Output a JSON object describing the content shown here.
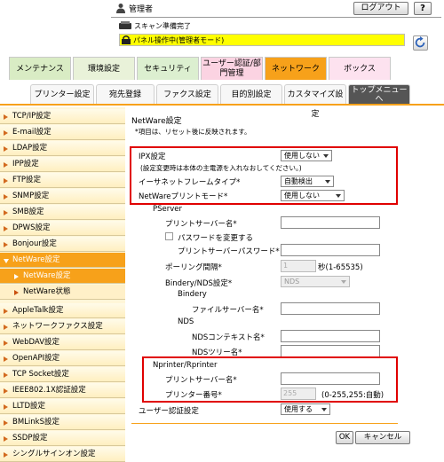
{
  "header": {
    "user_label": "管理者",
    "logout_label": "ログアウト",
    "help_label": "?",
    "scan_status": "スキャン準備完了",
    "panel_status": "パネル操作中(管理者モード)"
  },
  "main_tabs": [
    {
      "label": "メンテナンス",
      "color": "#d9ecc4"
    },
    {
      "label": "環境設定",
      "color": "#e9f2d9"
    },
    {
      "label": "セキュリティ",
      "color": "#dcefd0"
    },
    {
      "label": "ユーザー認証/部門管理",
      "color": "#fbd3e2"
    },
    {
      "label": "ネットワーク",
      "color": "#f7a11a"
    },
    {
      "label": "ボックス",
      "color": "#fde2ef"
    }
  ],
  "sub_tabs": [
    {
      "label": "プリンター設定"
    },
    {
      "label": "宛先登録"
    },
    {
      "label": "ファクス設定"
    },
    {
      "label": "目的別設定"
    },
    {
      "label": "カスタマイズ設定"
    },
    {
      "label": "トップメニューへ"
    }
  ],
  "sidebar": {
    "items": [
      {
        "label": "TCP/IP設定"
      },
      {
        "label": "E-mail設定"
      },
      {
        "label": "LDAP設定"
      },
      {
        "label": "IPP設定"
      },
      {
        "label": "FTP設定"
      },
      {
        "label": "SNMP設定"
      },
      {
        "label": "SMB設定"
      },
      {
        "label": "DPWS設定"
      },
      {
        "label": "Bonjour設定"
      },
      {
        "label": "NetWare設定"
      },
      {
        "label": "NetWare設定"
      },
      {
        "label": "NetWare状態"
      },
      {
        "label": "AppleTalk設定"
      },
      {
        "label": "ネットワークファクス設定"
      },
      {
        "label": "WebDAV設定"
      },
      {
        "label": "OpenAPI設定"
      },
      {
        "label": "TCP Socket設定"
      },
      {
        "label": "IEEE802.1X認証設定"
      },
      {
        "label": "LLTD設定"
      },
      {
        "label": "BMLinkS設定"
      },
      {
        "label": "SSDP設定"
      },
      {
        "label": "シングルサインオン設定"
      }
    ]
  },
  "form": {
    "title": "NetWare設定",
    "note": "*項目は、リセット後に反映されます。",
    "ipx_label": "IPX設定",
    "ipx_value": "使用しない",
    "ipx_note": "(設定変更時は本体の主電源を入れなおしてください。)",
    "frame_label": "イーサネットフレームタイプ*",
    "frame_value": "自動検出",
    "print_mode_label": "NetWareプリントモード*",
    "print_mode_value": "使用しない",
    "pserver_heading": "PServer",
    "print_server_name_label": "プリントサーバー名*",
    "print_server_name_value": "",
    "password_change_label": "パスワードを変更する",
    "print_server_password_label": "プリントサーバーパスワード*",
    "polling_label": "ポーリング間隔*",
    "polling_value": "1",
    "polling_unit": "秒(1-65535)",
    "bindery_nds_label": "Bindery/NDS設定*",
    "bindery_nds_value": "NDS",
    "bindery_heading": "Bindery",
    "file_server_label": "ファイルサーバー名*",
    "nds_heading": "NDS",
    "nds_context_label": "NDSコンテキスト名*",
    "nds_tree_label": "NDSツリー名*",
    "nprinter_heading": "Nprinter/Rprinter",
    "nprinter_server_label": "プリントサーバー名*",
    "printer_number_label": "プリンター番号*",
    "printer_number_value": "255",
    "printer_number_range": "(0-255,255:自動)",
    "user_auth_label": "ユーザー認証設定",
    "user_auth_value": "使用する",
    "ok_label": "OK",
    "cancel_label": "キャンセル"
  },
  "colors": {
    "accent": "#f7a11a",
    "highlight_box": "#e00000",
    "status_bar": "#ffff00"
  }
}
